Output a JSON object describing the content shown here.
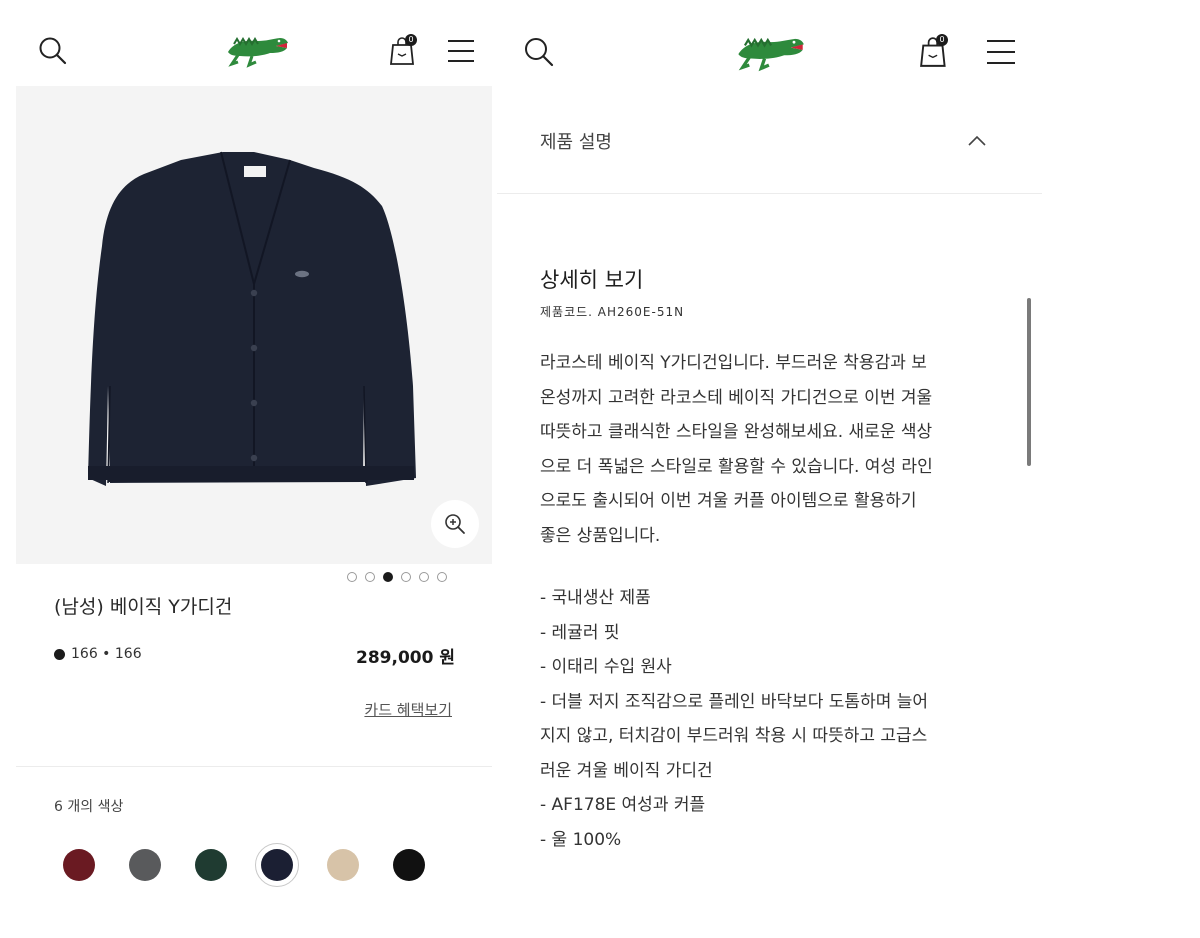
{
  "left": {
    "header": {
      "search_icon": "search-icon",
      "logo": "crocodile-logo",
      "bag_count": "0",
      "menu_icon": "hamburger-menu-icon"
    },
    "product": {
      "image_color": "#1d2333",
      "name": "(남성) 베이직 Y가디건",
      "meta_text": "166 • 166",
      "price": "289,000 원",
      "card_link": "카드 혜택보기"
    },
    "carousel": {
      "total": 6,
      "active_index": 2
    },
    "colors": {
      "label": "6 개의 색상",
      "swatches": [
        {
          "name": "burgundy",
          "hex": "#6a1a22"
        },
        {
          "name": "charcoal",
          "hex": "#595a5c"
        },
        {
          "name": "dark-green",
          "hex": "#1f3b31"
        },
        {
          "name": "navy",
          "hex": "#1b1f33",
          "selected": true
        },
        {
          "name": "beige",
          "hex": "#d7c3a8"
        },
        {
          "name": "black",
          "hex": "#111111"
        }
      ]
    }
  },
  "right": {
    "header": {
      "bag_count": "0"
    },
    "accordion": {
      "title": "제품 설명",
      "expanded": true
    },
    "details": {
      "title": "상세히 보기",
      "code": "제품코드. AH260E-51N",
      "description": [
        "라코스테 베이직 Y가디건입니다. 부드러운 착용감과 보",
        "온성까지 고려한 라코스테 베이직 가디건으로 이번 겨울",
        "따뜻하고 클래식한 스타일을 완성해보세요. 새로운 색상",
        "으로 더 폭넓은 스타일로 활용할 수 있습니다. 여성 라인",
        "으로도 출시되어 이번 겨울 커플 아이템으로 활용하기",
        "좋은 상품입니다.",
        "",
        " - 국내생산 제품",
        " - 레귤러 핏",
        " - 이태리 수입 원사",
        " - 더블 저지 조직감으로 플레인 바닥보다 도톰하며 늘어",
        "지지 않고, 터치감이 부드러워 착용 시 따뜻하고 고급스",
        "러운 겨울 베이직 가디건",
        " - AF178E 여성과 커플",
        " - 울 100%"
      ]
    }
  }
}
